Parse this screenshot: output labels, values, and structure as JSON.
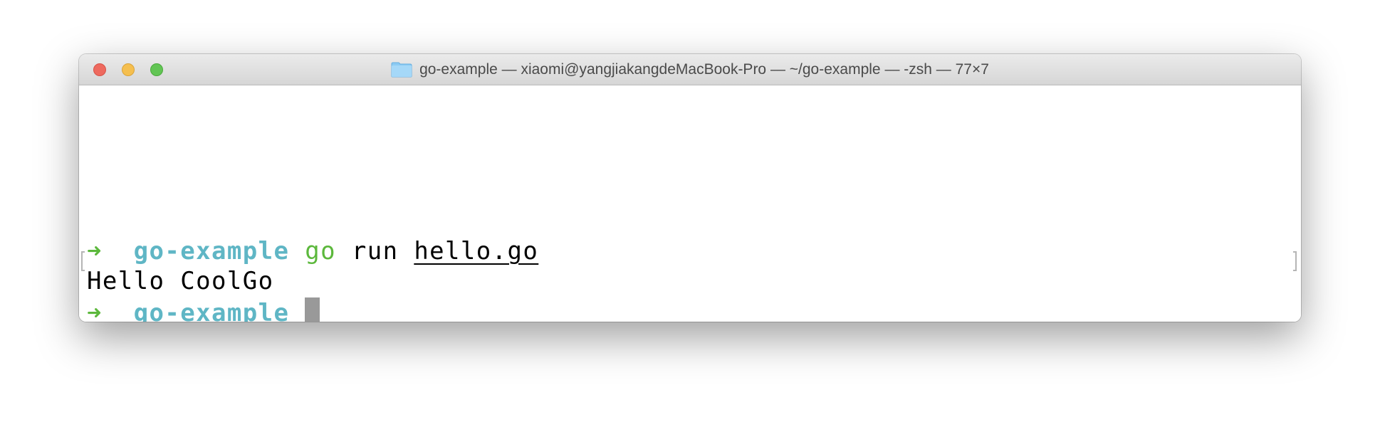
{
  "window": {
    "title": "go-example — xiaomi@yangjiakangdeMacBook-Pro — ~/go-example — -zsh — 77×7",
    "title_icon": "folder-icon",
    "traffic_lights": {
      "close": "#ee6a5f",
      "minimize": "#f5bf4f",
      "maximize": "#62c554"
    }
  },
  "terminal": {
    "lines": [
      {
        "arrow": "➜",
        "cwd": "go-example",
        "command": "go",
        "args": "run",
        "file": "hello.go"
      },
      {
        "output": "Hello CoolGo"
      },
      {
        "arrow": "➜",
        "cwd": "go-example"
      }
    ],
    "colors": {
      "arrow": "#5cb83c",
      "cwd": "#5fb6c5",
      "command": "#5cb83c",
      "cursor": "#999999"
    }
  }
}
